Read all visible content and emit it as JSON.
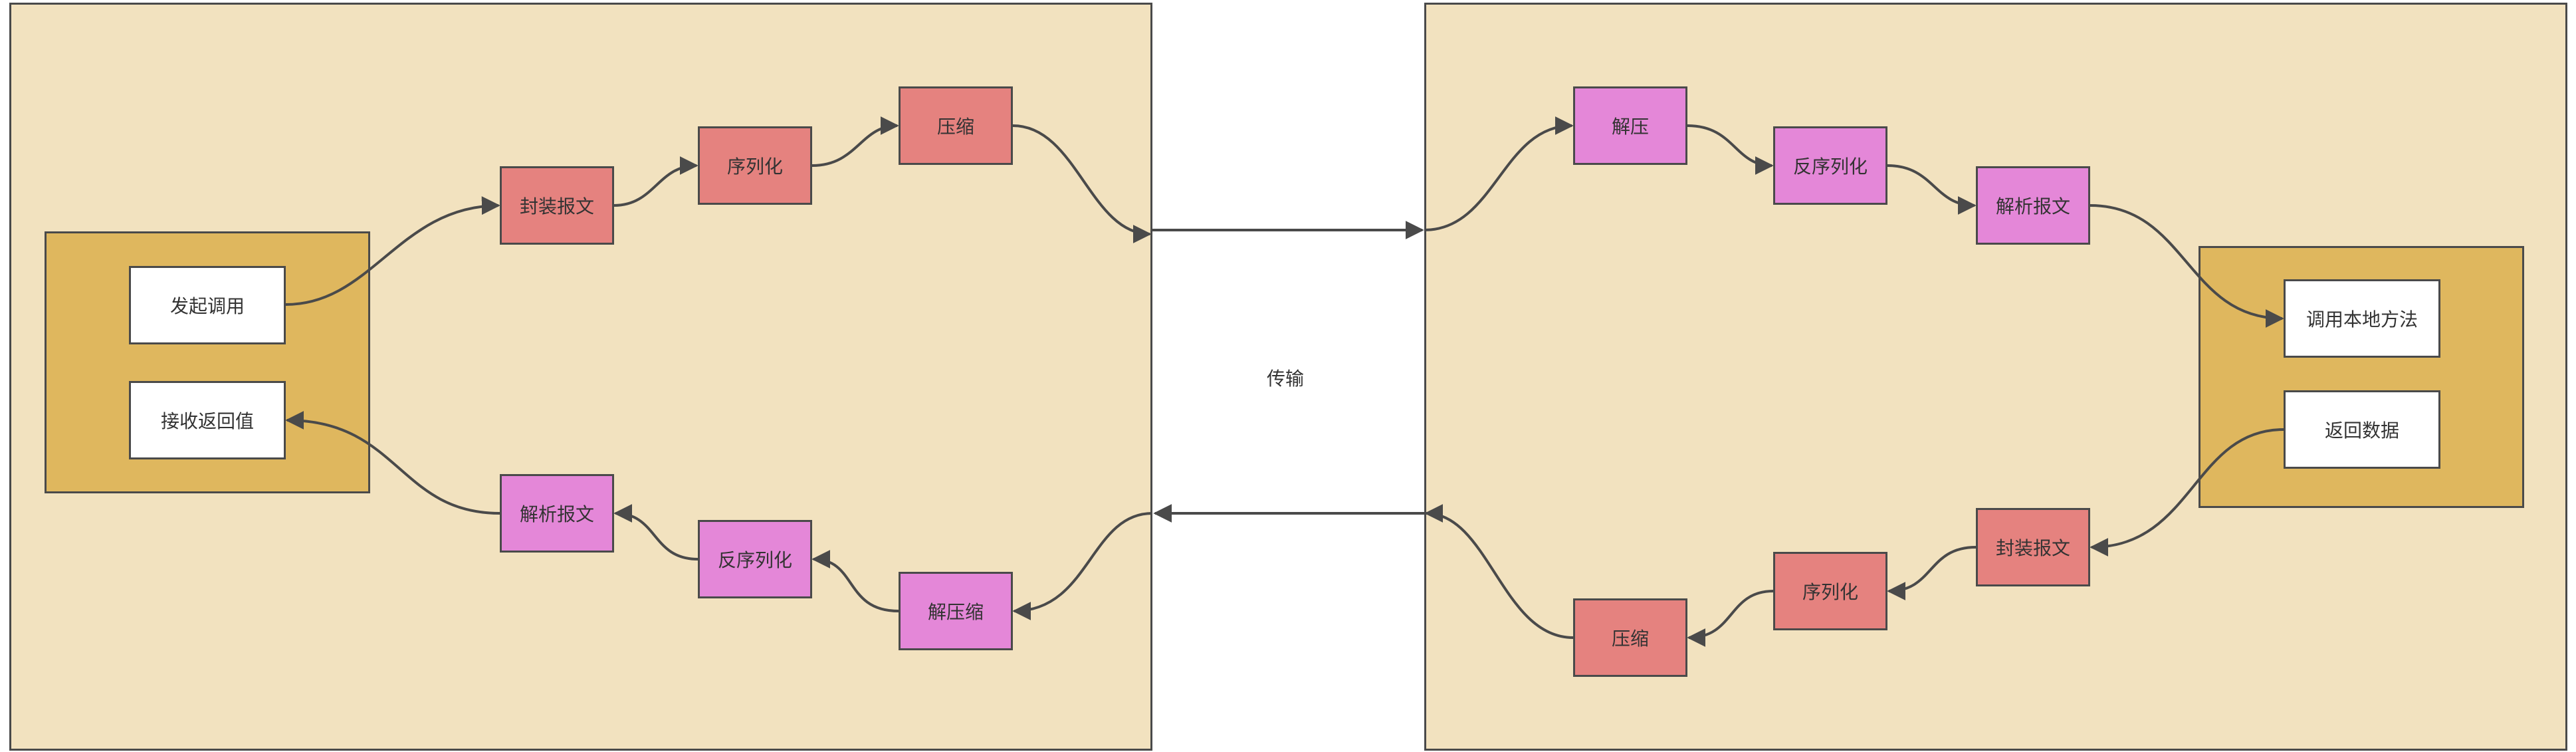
{
  "client": {
    "call": "发起调用",
    "receive": "接收返回值",
    "send_pipeline": [
      "封装报文",
      "序列化",
      "压缩"
    ],
    "recv_pipeline": [
      "解析报文",
      "反序列化",
      "解压缩"
    ]
  },
  "transport_label": "传输",
  "server": {
    "recv_pipeline": [
      "解压",
      "反序列化",
      "解析报文"
    ],
    "invoke": "调用本地方法",
    "return": "返回数据",
    "send_pipeline": [
      "封装报文",
      "序列化",
      "压缩"
    ]
  },
  "colors": {
    "panel": "#f2e2bf",
    "group": "#dfb75e",
    "send_node": "#e5827f",
    "recv_node": "#e487d8",
    "stroke": "#4a4a4a"
  }
}
